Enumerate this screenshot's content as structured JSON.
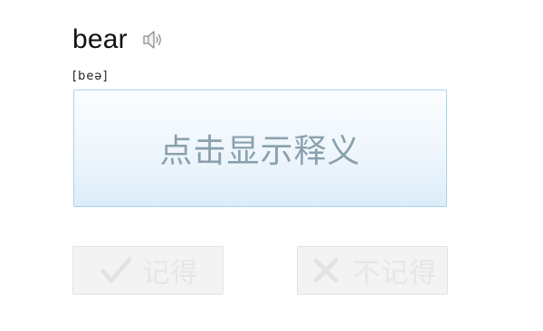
{
  "word": {
    "text": "bear",
    "phonetic": "[beə]",
    "speaker_icon": "speaker-icon"
  },
  "reveal": {
    "label": "点击显示释义"
  },
  "actions": {
    "remember": {
      "label": "记得",
      "icon": "check-icon"
    },
    "forget": {
      "label": "不记得",
      "icon": "cross-icon"
    }
  },
  "colors": {
    "reveal_border": "#a9d3ec",
    "reveal_text": "#8aa0ad",
    "button_bg": "#f3f3f3",
    "button_text": "#e6e6e6"
  }
}
